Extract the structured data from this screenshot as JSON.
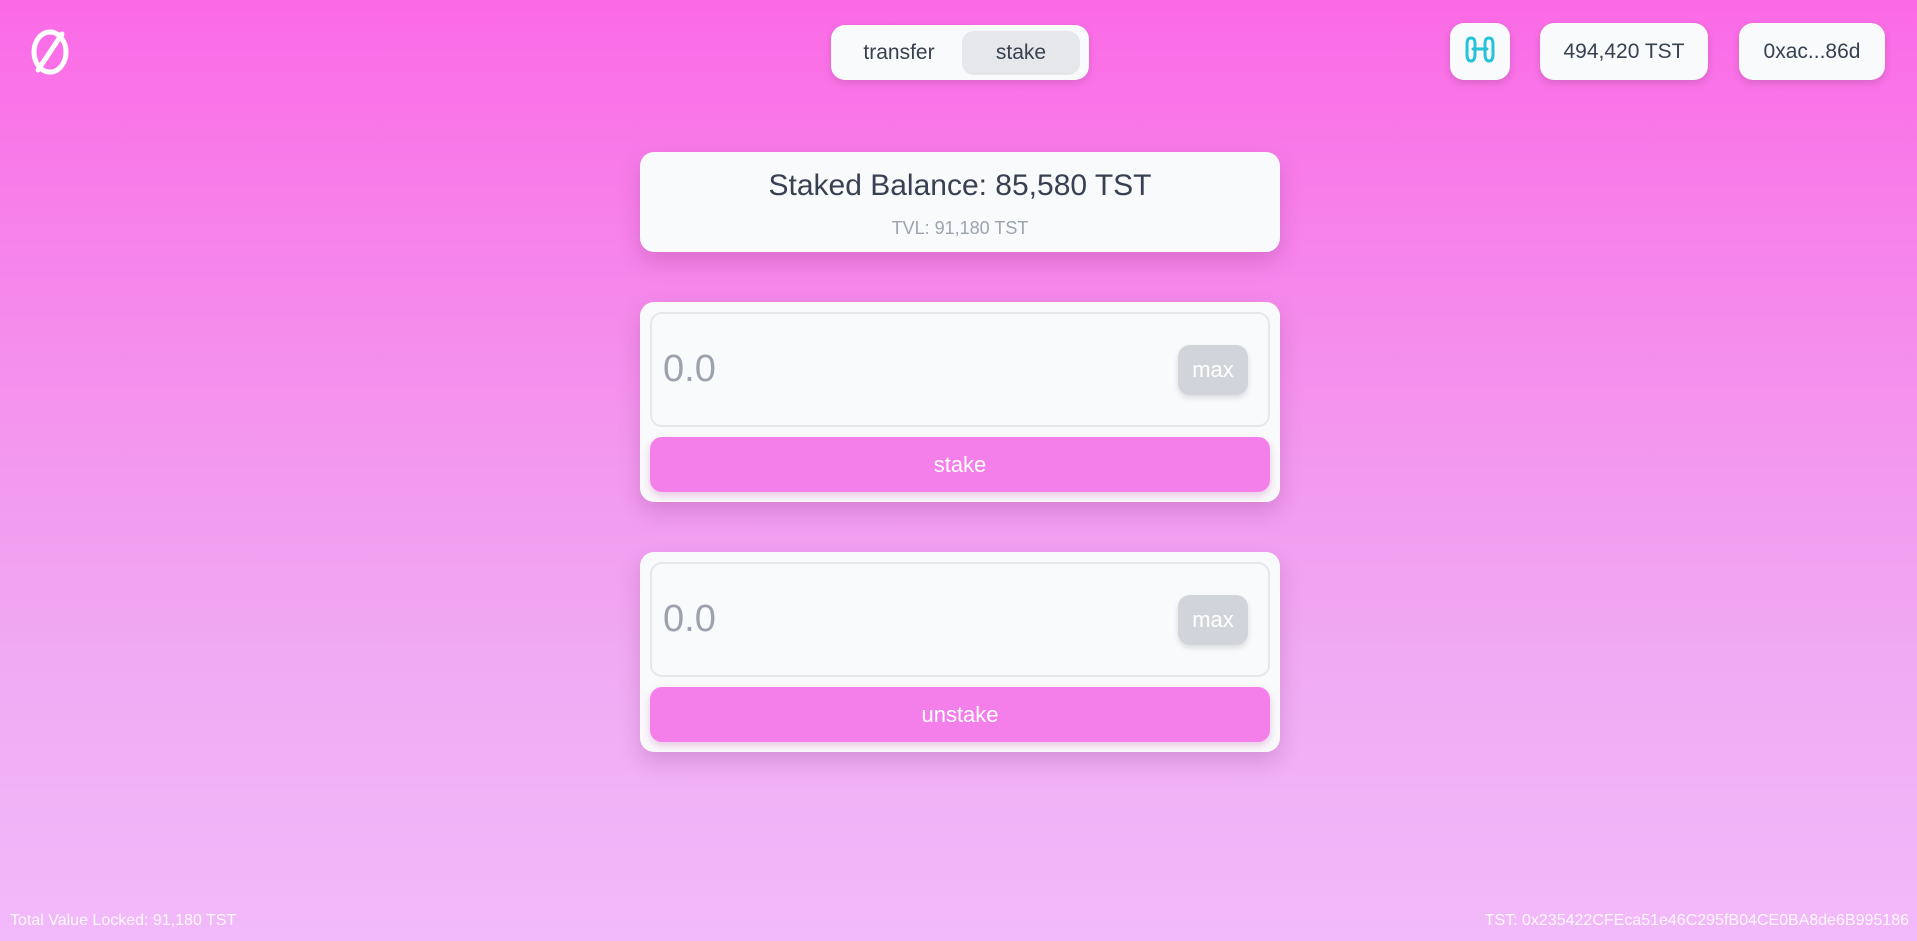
{
  "header": {
    "logo_icon": "slashed-zero-logo",
    "tabs": [
      {
        "label": "transfer",
        "active": false
      },
      {
        "label": "stake",
        "active": true
      }
    ],
    "network_icon": "harmony-icon",
    "network_color": "#25c3d8",
    "wallet_balance": "494,420 TST",
    "wallet_address": "0xac...86d"
  },
  "balance": {
    "title": "Staked Balance: 85,580 TST",
    "tvl": "TVL: 91,180 TST"
  },
  "stake_form": {
    "placeholder": "0.0",
    "max_label": "max",
    "button_label": "stake"
  },
  "unstake_form": {
    "placeholder": "0.0",
    "max_label": "max",
    "button_label": "unstake"
  },
  "footer": {
    "total_value_locked": "Total Value Locked: 91,180 TST",
    "token_address": "TST: 0x235422CFEca51e46C295fB04CE0BA8de6B995186"
  },
  "colors": {
    "accent": "#f57fea",
    "background_top": "#fb6ae6",
    "background_bottom": "#f2bafa"
  }
}
